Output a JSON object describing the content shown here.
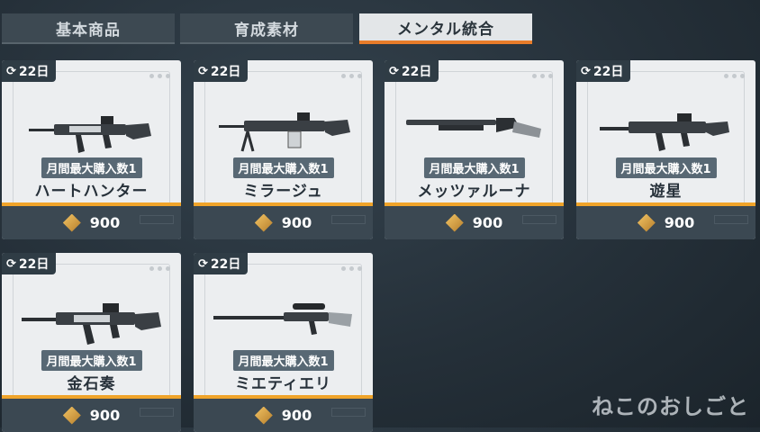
{
  "tabs": [
    {
      "label": "基本商品",
      "active": false
    },
    {
      "label": "育成素材",
      "active": false
    },
    {
      "label": "メンタル統合",
      "active": true
    }
  ],
  "accent_colors": {
    "tab_active": "#e87c2a",
    "card_stripe": "#f0a42a"
  },
  "items": [
    {
      "days": "22日",
      "limit": "月間最大購入数1",
      "name": "ハートハンター",
      "price": "900"
    },
    {
      "days": "22日",
      "limit": "月間最大購入数1",
      "name": "ミラージュ",
      "price": "900"
    },
    {
      "days": "22日",
      "limit": "月間最大購入数1",
      "name": "メッツァルーナ",
      "price": "900"
    },
    {
      "days": "22日",
      "limit": "月間最大購入数1",
      "name": "遊星",
      "price": "900"
    },
    {
      "days": "22日",
      "limit": "月間最大購入数1",
      "name": "金石奏",
      "price": "900"
    },
    {
      "days": "22日",
      "limit": "月間最大購入数1",
      "name": "ミエティエリ",
      "price": "900"
    }
  ],
  "watermark": "ねこのおしごと"
}
